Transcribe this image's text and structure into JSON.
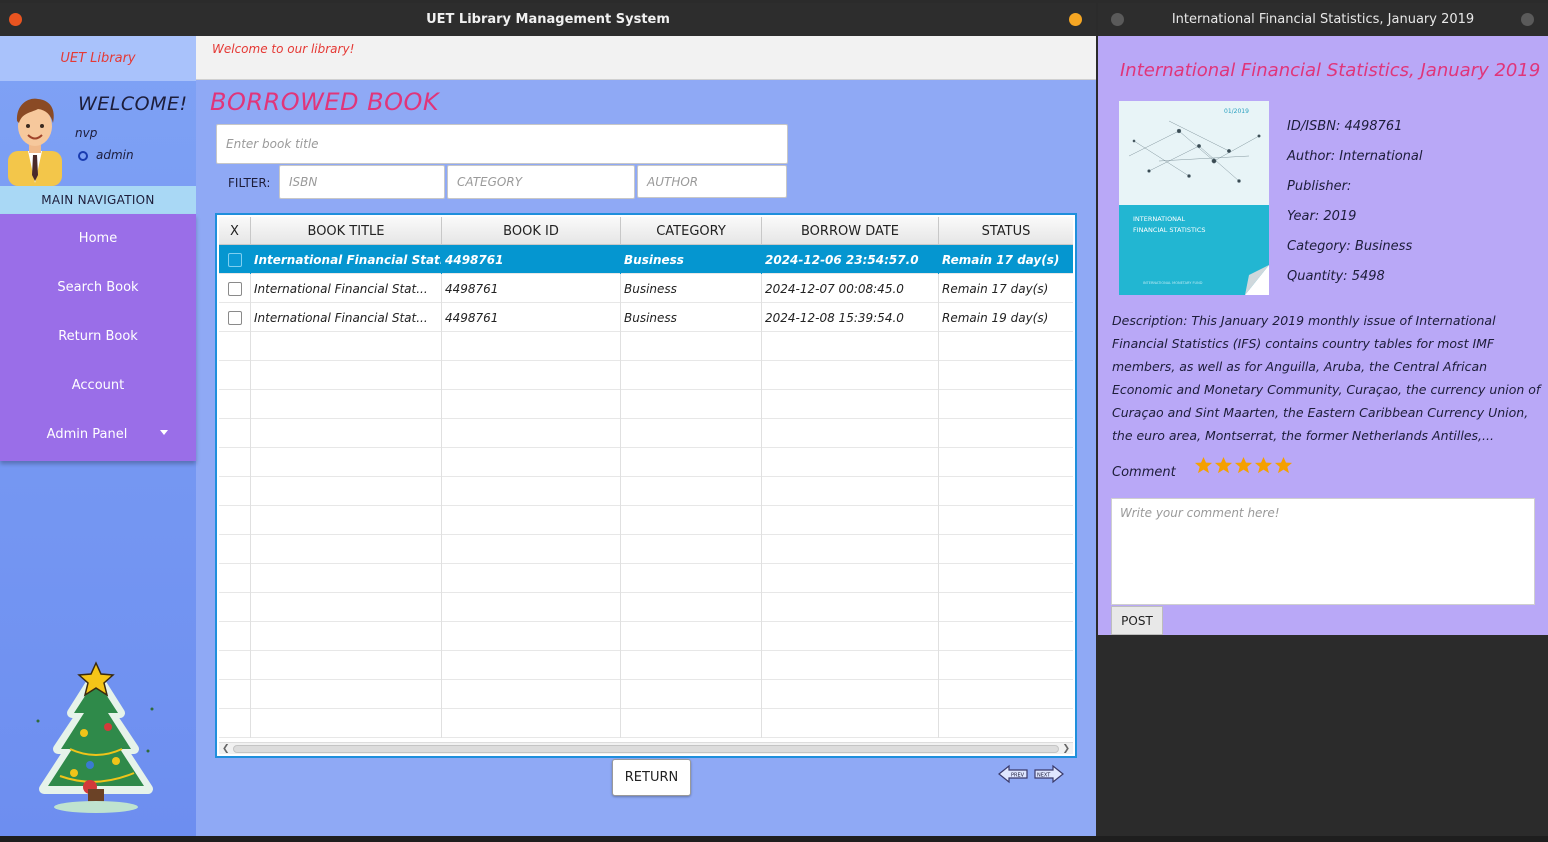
{
  "main_window": {
    "title": "UET Library Management System",
    "brand": "UET Library",
    "welcome_banner": "Welcome to our library!",
    "user": {
      "greeting": "WELCOME!",
      "name": "nvp",
      "role": "admin"
    },
    "nav_heading": "MAIN NAVIGATION",
    "nav_items": [
      "Home",
      "Search Book",
      "Return Book",
      "Account",
      "Admin Panel"
    ],
    "page_title": "BORROWED BOOK",
    "search": {
      "placeholder": "Enter book title"
    },
    "filter": {
      "label": "FILTER:",
      "isbn_placeholder": "ISBN",
      "category_placeholder": "CATEGORY",
      "author_placeholder": "AUTHOR"
    },
    "table": {
      "columns": [
        "X",
        "BOOK TITLE",
        "BOOK ID",
        "CATEGORY",
        "BORROW DATE",
        "STATUS"
      ],
      "rows": [
        {
          "title": "International Financial Stat...",
          "id": "4498761",
          "category": "Business",
          "date": "2024-12-06 23:54:57.0",
          "status": "Remain 17 day(s)",
          "selected": true
        },
        {
          "title": "International Financial Stat...",
          "id": "4498761",
          "category": "Business",
          "date": "2024-12-07 00:08:45.0",
          "status": "Remain 17 day(s)",
          "selected": false
        },
        {
          "title": "International Financial Stat...",
          "id": "4498761",
          "category": "Business",
          "date": "2024-12-08 15:39:54.0",
          "status": "Remain 19 day(s)",
          "selected": false
        }
      ]
    },
    "return_button": "RETURN",
    "pager": {
      "prev": "PREV",
      "next": "NEXT"
    }
  },
  "detail_window": {
    "title": "International Financial Statistics, January 2019",
    "book_title": "International Financial Statistics, January 2019",
    "cover": {
      "issue": "01/2019",
      "line1": "INTERNATIONAL",
      "line2": "FINANCIAL STATISTICS",
      "publisher": "INTERNATIONAL MONETARY FUND"
    },
    "isbn": "ID/ISBN: 4498761",
    "author": "Author: International",
    "publisher": "Publisher:",
    "year": "Year: 2019",
    "category": "Category: Business",
    "quantity": "Quantity: 5498",
    "description": "Description: This January 2019 monthly issue of International Financial Statistics (IFS) contains country tables for most IMF members, as well as for Anguilla, Aruba, the Central African Economic and Monetary Community, Curaçao, the currency union of Curaçao and Sint Maarten, the Eastern Caribbean Currency Union, the euro area, Montserrat, the former Netherlands Antilles,...",
    "comment_label": "Comment",
    "rating": 5,
    "comment_placeholder": "Write your comment here!",
    "post_button": "POST"
  },
  "colors": {
    "accent_pink": "#e0357a",
    "selection_blue": "#0596d0",
    "nav_purple": "#9a6ee8",
    "star": "#f5a000"
  },
  "icons": [
    "avatar-icon",
    "christmas-tree-icon",
    "dropdown-caret-icon",
    "prev-page-icon",
    "next-page-icon",
    "star-icon"
  ]
}
